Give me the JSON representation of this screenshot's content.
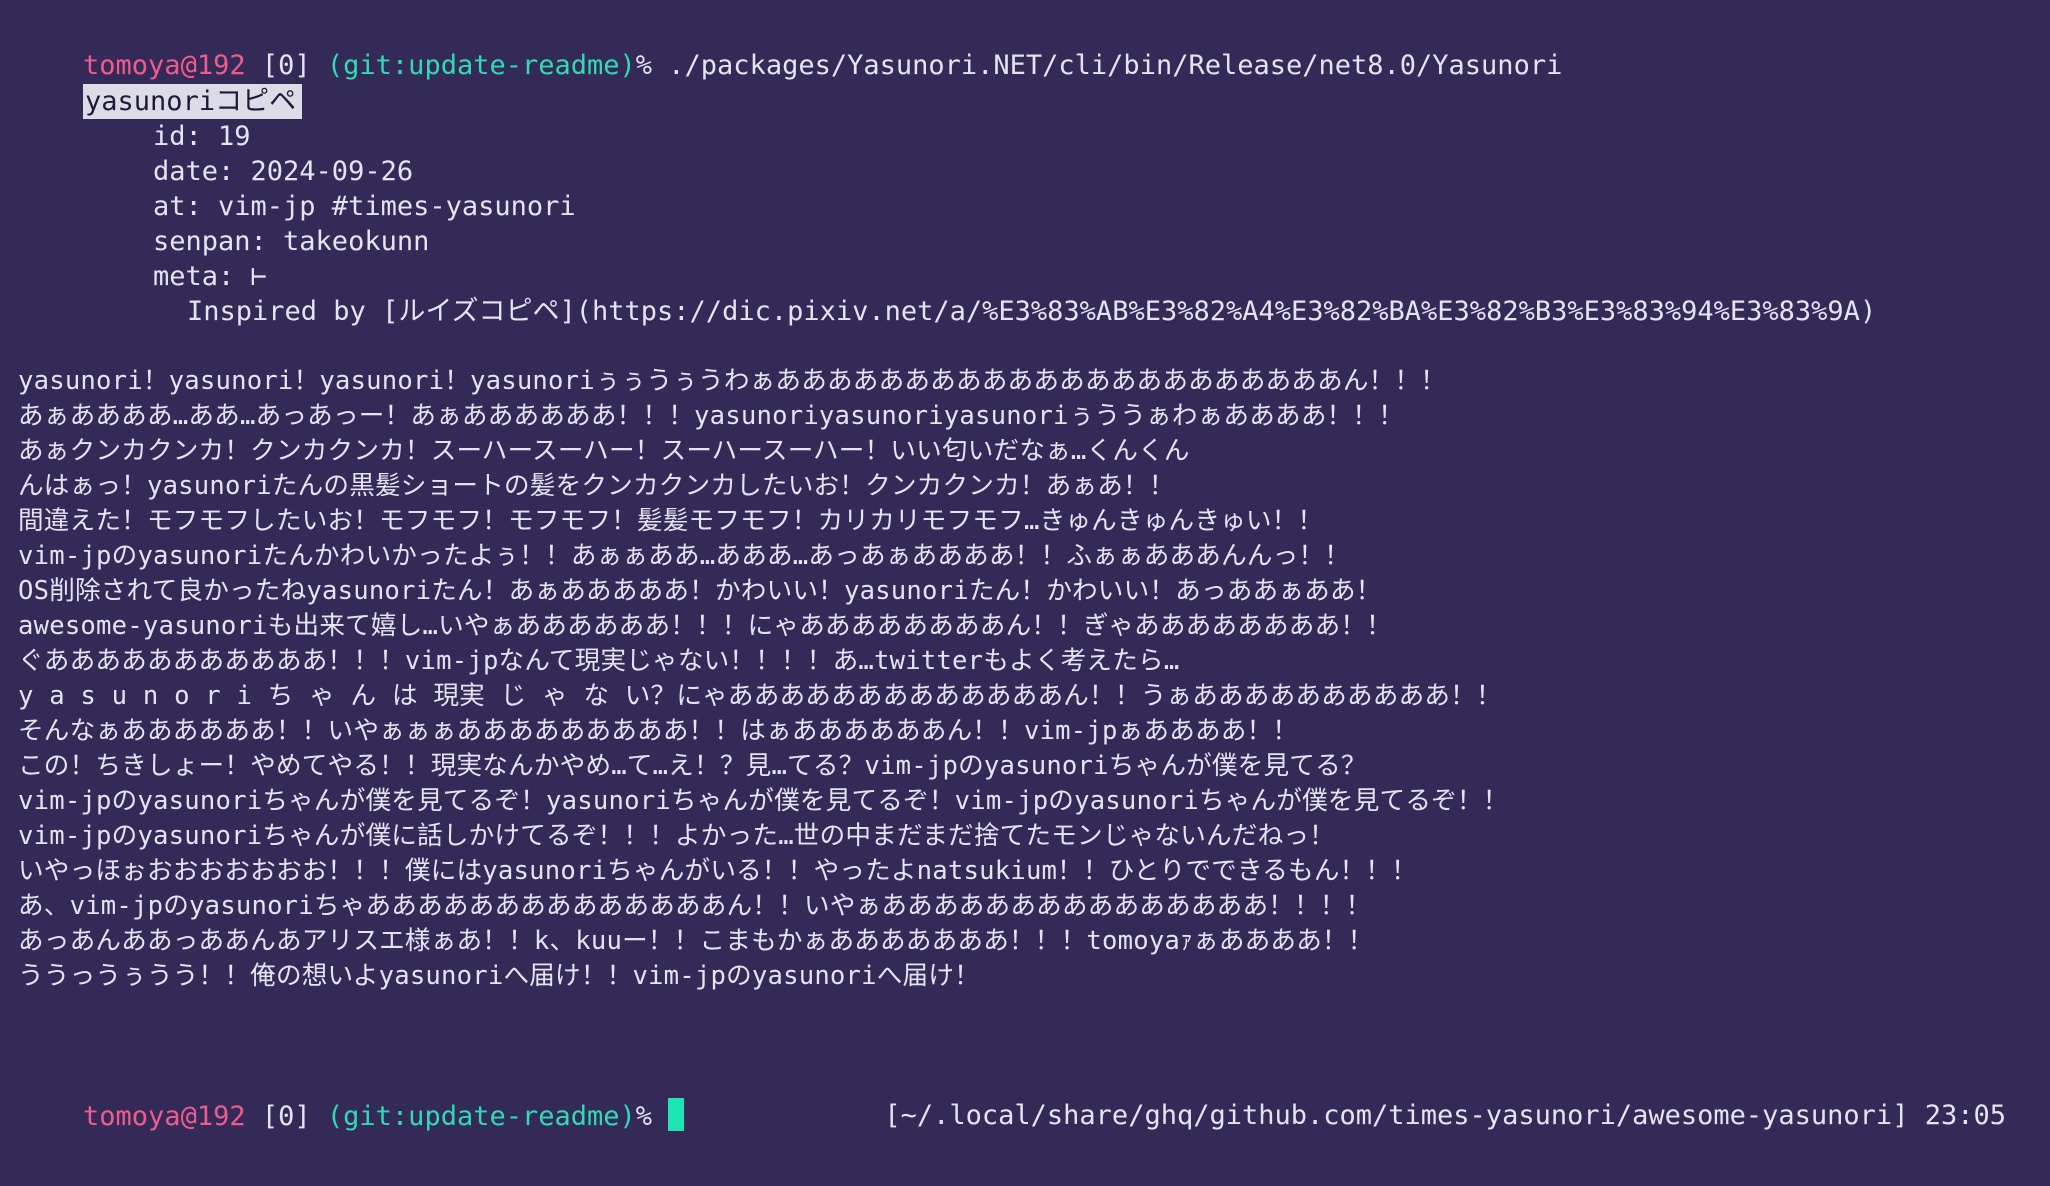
{
  "prompt": {
    "user_host": "tomoya@192",
    "index": "[0]",
    "branch": "(git:update-readme)",
    "symbol": "%"
  },
  "command": " ./packages/Yasunori.NET/cli/bin/Release/net8.0/Yasunori",
  "entry": {
    "title": "yasunoriコピペ",
    "id_line": "id: 19",
    "date_line": "date: 2024-09-26",
    "at_line": "at: vim-jp #times-yasunori",
    "senpan_line": "senpan: takeokunn",
    "meta_line": "meta: ⊢",
    "meta_detail": "Inspired by [ルイズコピペ](https://dic.pixiv.net/a/%E3%83%AB%E3%82%A4%E3%82%BA%E3%82%B3%E3%83%94%E3%83%9A)",
    "content": [
      "yasunori！yasunori！yasunori！yasunoriぅぅうぅうわぁああああああああああああああああああああああん！！！",
      "あぁああああ…ああ…あっあっー！あぁああああああ！！！yasunoriyasunoriyasunoriぅううぁわぁああああ！！！",
      "あぁクンカクンカ！クンカクンカ！スーハースーハー！スーハースーハー！いい匂いだなぁ…くんくん",
      "んはぁっ！yasunoriたんの黒髪ショートの髪をクンカクンカしたいお！クンカクンカ！あぁあ！！",
      "間違えた！モフモフしたいお！モフモフ！モフモフ！髪髪モフモフ！カリカリモフモフ…きゅんきゅんきゅい！！",
      "vim-jpのyasunoriたんかわいかったよぅ！！あぁぁああ…あああ…あっあぁああああ！！ふぁぁあああんんっ！！",
      "OS削除されて良かったねyasunoriたん！あぁあああああ！かわいい！yasunoriたん！かわいい！あっああぁああ！",
      "awesome-yasunoriも出来て嬉し…いやぁああああああ！！！にゃああああああああん！！ぎゃああああああああ！！",
      "ぐあああああああああああ！！！vim-jpなんて現実じゃない！！！！あ…twitterもよく考えたら…",
      "y a s u n o r i ち ゃ ん は 現実 じ ゃ な い？にゃあああああああああああああん！！うぁああああああああああ！！",
      "そんなぁああああああ！！いやぁぁぁあああああああああ！！はぁああああああん！！vim-jpぁああああ！！",
      "この！ちきしょー！やめてやる！！現実なんかやめ…て…え！？見…てる？vim-jpのyasunoriちゃんが僕を見てる？",
      "vim-jpのyasunoriちゃんが僕を見てるぞ！yasunoriちゃんが僕を見てるぞ！vim-jpのyasunoriちゃんが僕を見てるぞ！！",
      "vim-jpのyasunoriちゃんが僕に話しかけてるぞ！！！よかった…世の中まだまだ捨てたモンじゃないんだねっ！",
      "いやっほぉおおおおおおお！！！僕にはyasunoriちゃんがいる！！やったよnatsukium！！ひとりでできるもん！！！",
      "あ、vim-jpのyasunoriちゃああああああああああああああん！！いやぁあああああああああああああああ！！！！",
      "あっあんああっああんあアリスエ様ぁあ！！k、kuuー！！こまもかぁあああああああ！！！tomoyaｧぁああああ！！",
      "ううっうぅうう！！俺の想いよyasunoriへ届け！！vim-jpのyasunoriへ届け！"
    ]
  },
  "right_prompt": {
    "path": "[~/.local/share/ghq/github.com/times-yasunori/awesome-yasunori]",
    "time": "23:05"
  }
}
